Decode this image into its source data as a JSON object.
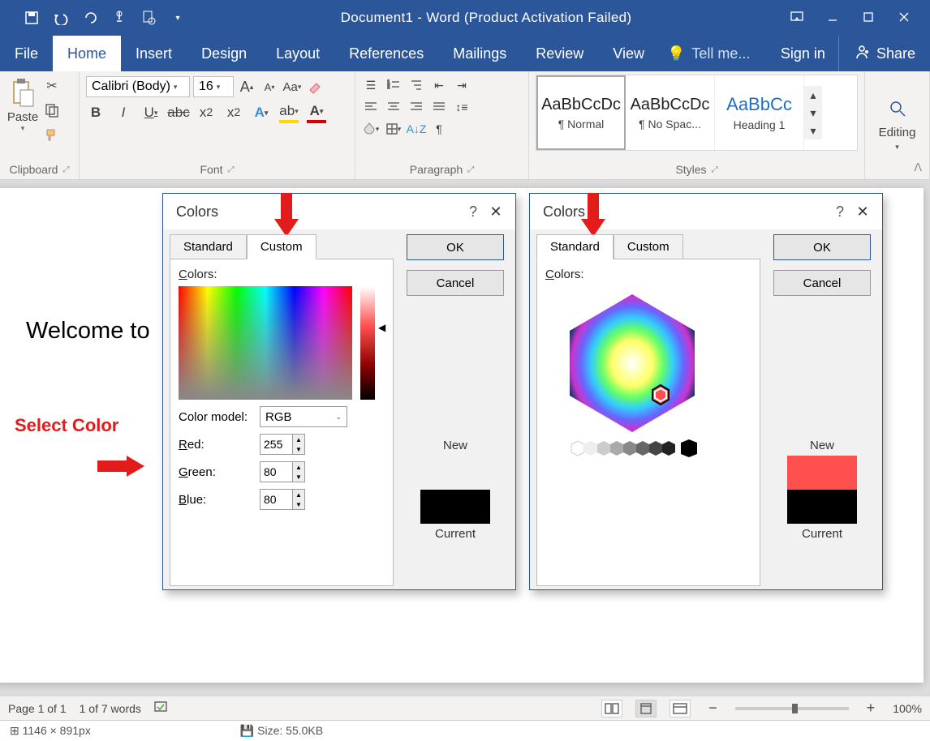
{
  "titlebar": {
    "doc_title": "Document1 - Word (Product Activation Failed)"
  },
  "tabs": {
    "file": "File",
    "home": "Home",
    "insert": "Insert",
    "design": "Design",
    "layout": "Layout",
    "references": "References",
    "mailings": "Mailings",
    "review": "Review",
    "view": "View",
    "tell": "Tell me...",
    "signin": "Sign in",
    "share": "Share"
  },
  "ribbon": {
    "clipboard": {
      "paste": "Paste",
      "label": "Clipboard"
    },
    "font": {
      "name": "Calibri (Body)",
      "size": "16",
      "label": "Font"
    },
    "paragraph": {
      "label": "Paragraph"
    },
    "styles": {
      "items": [
        {
          "preview": "AaBbCcDc",
          "name": "¶ Normal"
        },
        {
          "preview": "AaBbCcDc",
          "name": "¶ No Spac..."
        },
        {
          "preview": "AaBbCc",
          "name": "Heading 1"
        }
      ],
      "label": "Styles"
    },
    "editing": {
      "label": "Editing"
    }
  },
  "document": {
    "text": "Welcome to",
    "annotation": "Select Color"
  },
  "dialog_custom": {
    "title": "Colors",
    "help": "?",
    "tab_standard": "Standard",
    "tab_custom": "Custom",
    "ok": "OK",
    "cancel": "Cancel",
    "colors_label": "Colors:",
    "model_label": "Color model:",
    "model_value": "RGB",
    "red_label": "Red:",
    "red_value": "255",
    "green_label": "Green:",
    "green_value": "80",
    "blue_label": "Blue:",
    "blue_value": "80",
    "new": "New",
    "current": "Current",
    "new_color": "#ff5050",
    "current_color": "#000000"
  },
  "dialog_standard": {
    "title": "Colors",
    "help": "?",
    "tab_standard": "Standard",
    "tab_custom": "Custom",
    "ok": "OK",
    "cancel": "Cancel",
    "colors_label": "Colors:",
    "new": "New",
    "current": "Current",
    "new_color": "#ff5050",
    "current_color": "#000000"
  },
  "status": {
    "page": "Page 1 of 1",
    "words": "1 of 7 words",
    "zoom": "100%",
    "minus": "−",
    "plus": "+"
  },
  "bottom": {
    "dims": "1146 × 891px",
    "size": "Size: 55.0KB"
  }
}
